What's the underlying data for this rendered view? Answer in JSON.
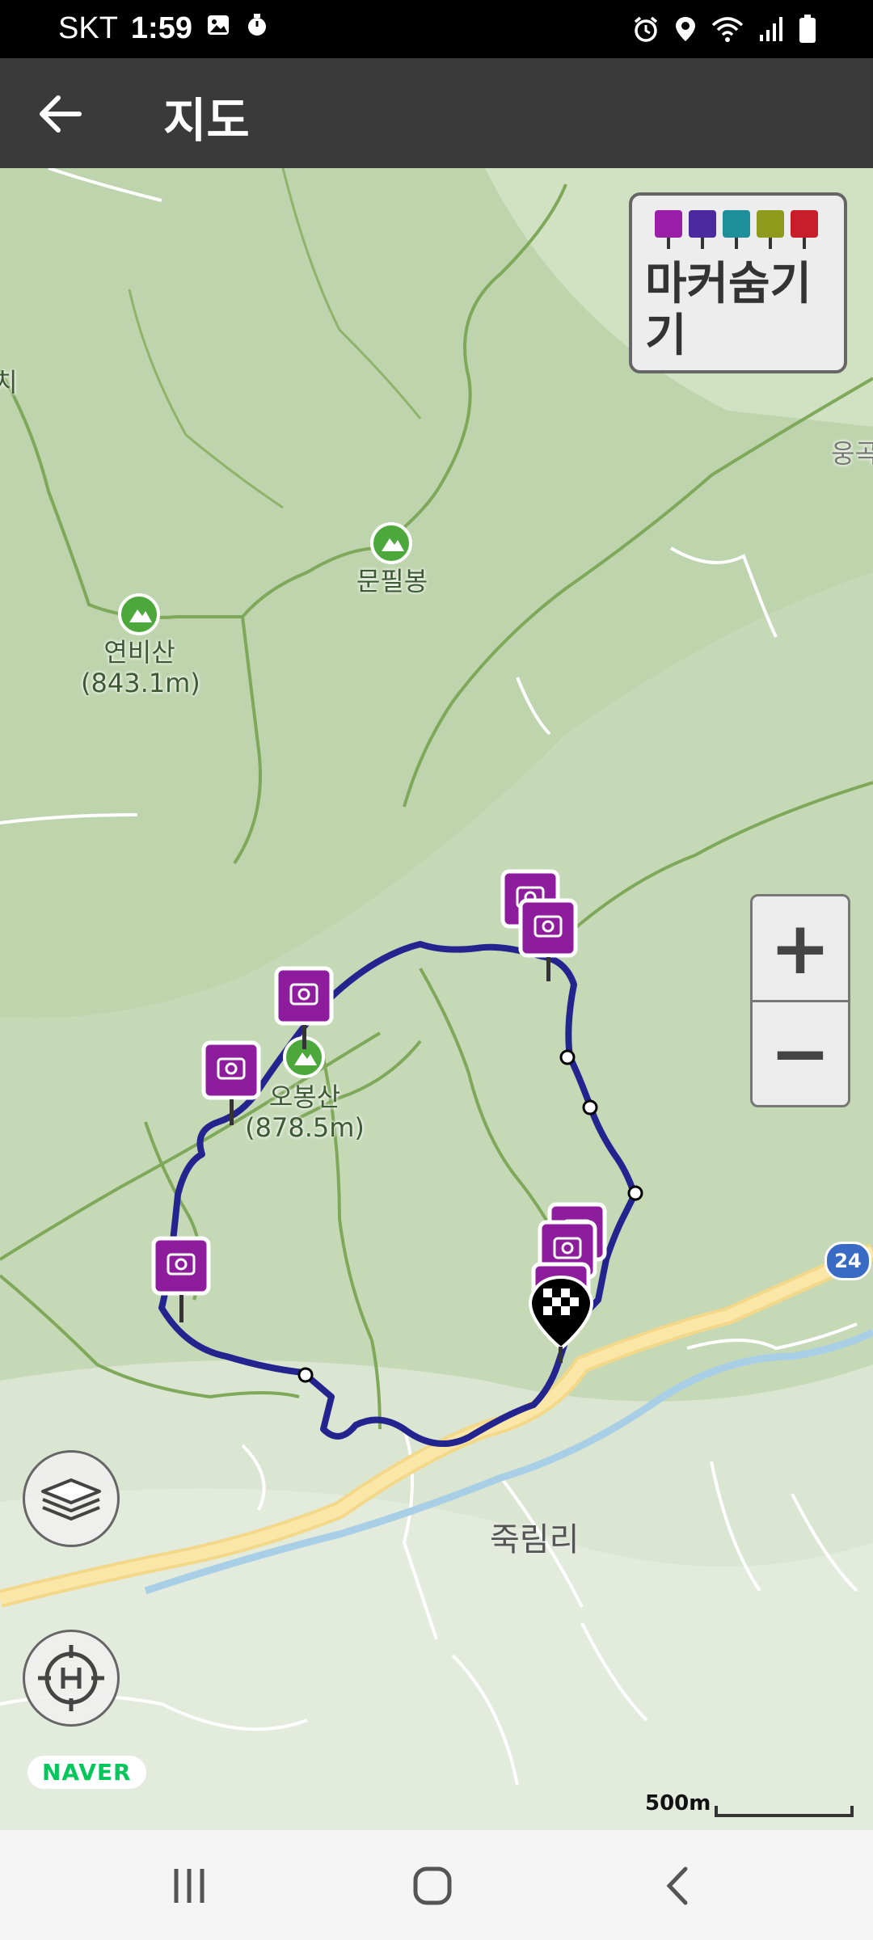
{
  "status_bar": {
    "carrier": "SKT",
    "time": "1:59",
    "left_icons": [
      "image-icon",
      "timer-icon"
    ],
    "right_icons": [
      "alarm-icon",
      "location-icon",
      "wifi-icon",
      "signal-icon",
      "battery-icon"
    ]
  },
  "app_bar": {
    "title": "지도",
    "back_icon": "arrow-left-icon"
  },
  "map": {
    "provider_logo": "NAVER",
    "scale_label": "500m",
    "route_color": "#1f2a8c",
    "marker_color": "#8e1d9e",
    "places": [
      {
        "name": "연비산",
        "sub": "(843.1m)",
        "type": "peak"
      },
      {
        "name": "문필봉",
        "sub": "",
        "type": "peak"
      },
      {
        "name": "오봉산",
        "sub": "(878.5m)",
        "type": "peak"
      }
    ],
    "villages": [
      "죽림리"
    ],
    "edge_labels": [
      "치",
      "웅곡"
    ],
    "road_badge": "24",
    "photo_markers": 8,
    "finish_marker": "checkered-flag"
  },
  "marker_toggle": {
    "label": "마커숨기기",
    "icon_colors": [
      "#9b1ea8",
      "#4a2a9e",
      "#1c8f9a",
      "#8e9a1c",
      "#c81e2a"
    ]
  },
  "zoom": {
    "in_label": "+",
    "out_label": "−"
  },
  "controls": {
    "layers_icon": "layers-icon",
    "home_icon": "home-location-icon"
  },
  "nav_bar": {
    "recent_icon": "recent-apps-icon",
    "home_icon": "home-icon",
    "back_icon": "back-icon"
  }
}
